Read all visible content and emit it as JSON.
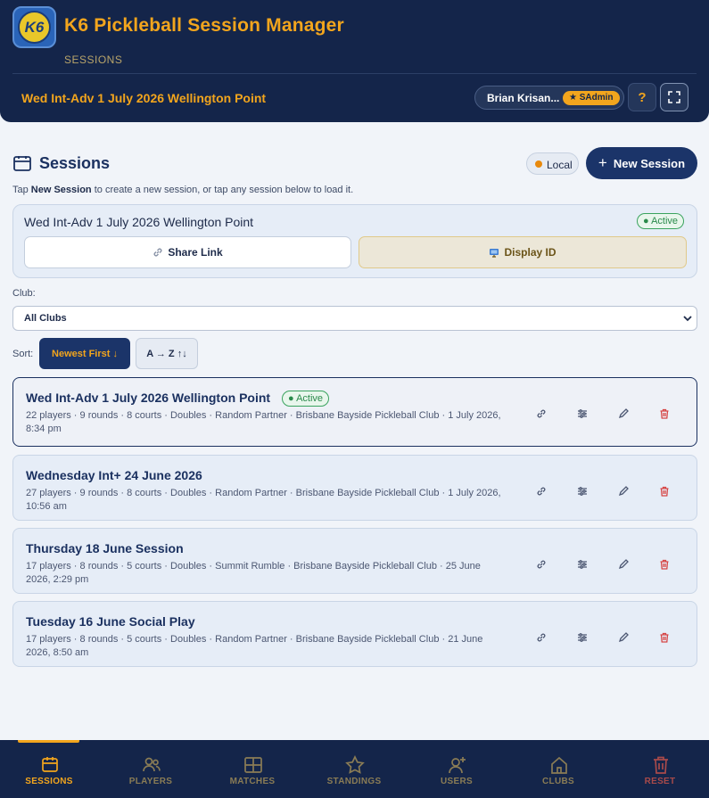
{
  "header": {
    "logo_text": "K6",
    "title": "K6 Pickleball Session Manager",
    "subtitle": "SESSIONS",
    "current_session": "Wed Int-Adv 1 July 2026 Wellington Point",
    "user_name": "Brian Krisan...",
    "user_role": "★ SAdmin",
    "help_label": "?"
  },
  "sessions_section": {
    "title": "Sessions",
    "storage_label": "Local",
    "new_session_label": "New Session",
    "hint_prefix": "Tap ",
    "hint_bold": "New Session",
    "hint_suffix": " to create a new session, or tap any session below to load it."
  },
  "active_card": {
    "name": "Wed Int-Adv 1 July 2026 Wellington Point",
    "badge": "● Active",
    "share_label": "Share Link",
    "display_label": "Display ID"
  },
  "filters": {
    "club_label": "Club:",
    "club_value": "All Clubs",
    "sort_label": "Sort:",
    "sort_newest": "Newest First ↓",
    "sort_az": "A → Z ↑↓"
  },
  "sessions": [
    {
      "title": "Wed Int-Adv 1 July 2026 Wellington Point",
      "badge": "● Active",
      "meta": "22 players · 9 rounds · 8 courts · Doubles · Random Partner · Brisbane Bayside Pickleball Club · 1 July 2026, 8:34 pm"
    },
    {
      "title": "Wednesday Int+ 24 June 2026",
      "meta": "27 players · 9 rounds · 8 courts · Doubles · Random Partner · Brisbane Bayside Pickleball Club · 1 July 2026, 10:56 am"
    },
    {
      "title": "Thursday 18 June Session",
      "meta": "17 players · 8 rounds · 5 courts · Doubles · Summit Rumble · Brisbane Bayside Pickleball Club · 25 June 2026, 2:29 pm"
    },
    {
      "title": "Tuesday 16 June Social Play",
      "meta": "17 players · 8 rounds · 5 courts · Doubles · Random Partner · Brisbane Bayside Pickleball Club · 21 June 2026, 8:50 am"
    }
  ],
  "nav": [
    {
      "label": "SESSIONS",
      "icon": "calendar-icon"
    },
    {
      "label": "PLAYERS",
      "icon": "users-icon"
    },
    {
      "label": "MATCHES",
      "icon": "grid-icon"
    },
    {
      "label": "STANDINGS",
      "icon": "star-icon"
    },
    {
      "label": "USERS",
      "icon": "user-plus-icon"
    },
    {
      "label": "CLUBS",
      "icon": "home-icon"
    },
    {
      "label": "RESET",
      "icon": "trash-icon"
    }
  ],
  "colors": {
    "navy": "#14254a",
    "accent": "#f2a51d",
    "active_green": "#2a8a4b",
    "danger": "#d64545"
  }
}
